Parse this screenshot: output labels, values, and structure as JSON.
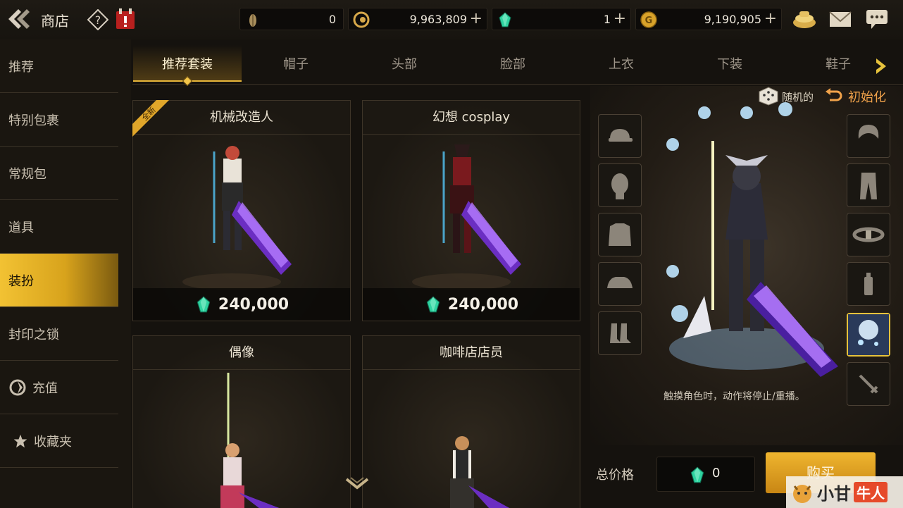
{
  "header": {
    "title": "商店",
    "currencies": [
      {
        "name": "fatigue",
        "value": "0",
        "has_plus": false
      },
      {
        "name": "gold-c",
        "value": "9,963,809",
        "has_plus": true
      },
      {
        "name": "cera",
        "value": "1",
        "has_plus": true
      },
      {
        "name": "gold-coin",
        "value": "9,190,905",
        "has_plus": true
      }
    ],
    "icons": [
      "back-icon",
      "help-icon",
      "calendar-icon",
      "treasure-bowl-icon",
      "mail-icon",
      "chat-icon"
    ]
  },
  "sidebar": {
    "items": [
      {
        "label": "推荐",
        "active": false
      },
      {
        "label": "特别包裹",
        "active": false
      },
      {
        "label": "常规包",
        "active": false
      },
      {
        "label": "道具",
        "active": false
      },
      {
        "label": "装扮",
        "active": true
      },
      {
        "label": "封印之锁",
        "active": false
      },
      {
        "label": "充值",
        "active": false,
        "icon": "recharge-icon"
      },
      {
        "label": "收藏夹",
        "active": false,
        "icon": "star-icon"
      }
    ]
  },
  "tabs": {
    "items": [
      {
        "label": "推荐套装",
        "active": true
      },
      {
        "label": "帽子",
        "active": false
      },
      {
        "label": "头部",
        "active": false
      },
      {
        "label": "脸部",
        "active": false
      },
      {
        "label": "上衣",
        "active": false
      },
      {
        "label": "下装",
        "active": false
      },
      {
        "label": "鞋子",
        "active": false
      }
    ]
  },
  "products": [
    {
      "title": "机械改造人",
      "price": "240,000",
      "badge": "全新"
    },
    {
      "title": "幻想 cosplay",
      "price": "240,000"
    },
    {
      "title": "偶像",
      "price": ""
    },
    {
      "title": "咖啡店店员",
      "price": ""
    }
  ],
  "preview": {
    "random_label": "随机的",
    "reset_label": "初始化",
    "hint": "触摸角色时，动作将停止/重播。",
    "left_slots": [
      "hat-slot-icon",
      "head-slot-icon",
      "top-slot-icon",
      "shoulder-slot-icon",
      "shoes-slot-icon"
    ],
    "right_slots": [
      "hair-slot-icon",
      "pants-slot-icon",
      "belt-slot-icon",
      "spray-slot-icon",
      "aura-slot-icon",
      "weapon-slot-icon"
    ]
  },
  "purchase": {
    "total_label": "总价格",
    "total_value": "0",
    "buy_label": "购买"
  },
  "watermark": {
    "text_a": "小甘",
    "text_b": "牛人"
  },
  "colors": {
    "accent": "#e6b53a",
    "active_side": "#f2c233",
    "reset": "#f0a24a",
    "gem": "#2fd3a0"
  }
}
